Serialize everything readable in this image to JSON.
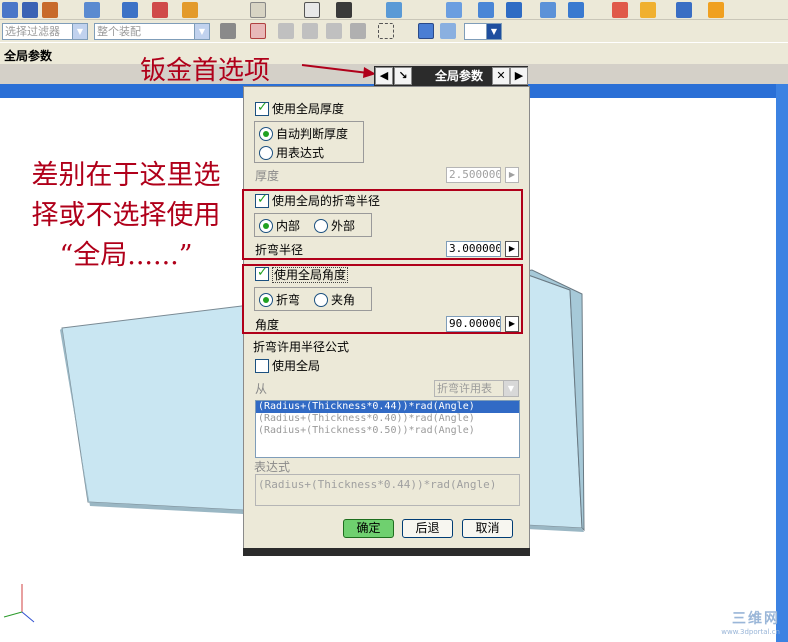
{
  "toolbar": {
    "selection_filter": "选择过滤器",
    "assembly_scope": "整个装配"
  },
  "tabbar": {
    "label": "全局参数"
  },
  "annotations": {
    "title": "钣金首选项",
    "difference_lines": [
      "差别在于这里选",
      "择或不选择使用",
      "“全局......”"
    ]
  },
  "dialog": {
    "title": "全局参数",
    "use_global_thickness": "使用全局厚度",
    "auto_thickness": "自动判断厚度",
    "use_expression": "用表达式",
    "thickness_label": "厚度",
    "thickness_value": "2.500000",
    "use_global_bend_radius": "使用全局的折弯半径",
    "inner": "内部",
    "outer": "外部",
    "bend_radius_label": "折弯半径",
    "bend_radius_value": "3.000000",
    "use_global_angle": "使用全局角度",
    "bend": "折弯",
    "included_angle": "夹角",
    "angle_label": "角度",
    "angle_value": "90.000000",
    "bend_allowance_section": "折弯许用半径公式",
    "use_global": "使用全局",
    "from_label": "从",
    "from_value": "折弯许用表",
    "formulas": [
      "(Radius+(Thickness*0.44))*rad(Angle)",
      "(Radius+(Thickness*0.40))*rad(Angle)",
      "(Radius+(Thickness*0.50))*rad(Angle)"
    ],
    "expression_label": "表达式",
    "expression_value": "(Radius+(Thickness*0.44))*rad(Angle)",
    "ok": "确定",
    "back": "后退",
    "cancel": "取消"
  },
  "watermark": {
    "text": "三维网",
    "url": "www.3dportal.cn"
  },
  "colors": {
    "annotation": "#b0001a",
    "viewport_bar": "#2a6fd6",
    "check": "#21a121"
  }
}
